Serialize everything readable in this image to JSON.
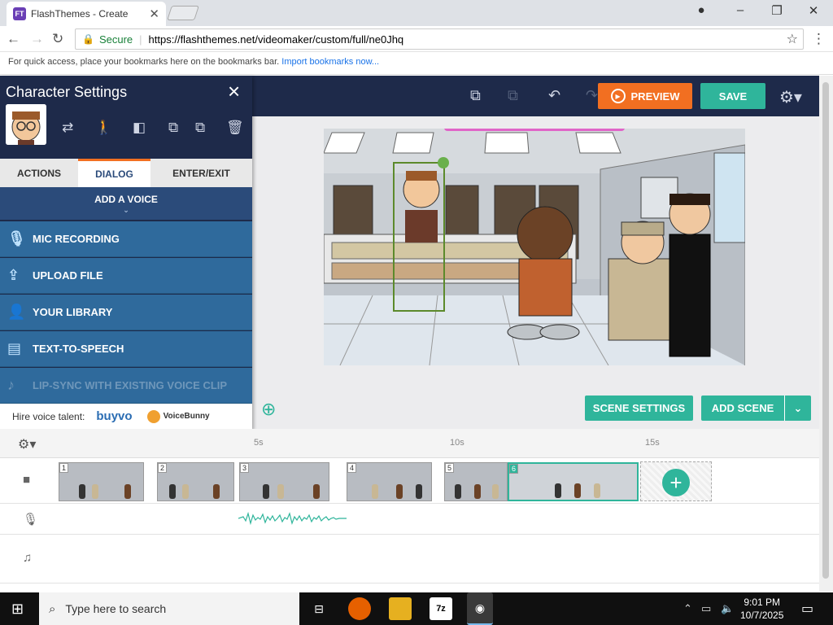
{
  "browser": {
    "tab_title": "FlashThemes - Create",
    "tab_close": "✕",
    "secure_label": "Secure",
    "url": "https://flashthemes.net/videomaker/custom/full/ne0Jhq",
    "bookmarks_text": "For quick access, place your bookmarks here on the bookmarks bar.",
    "bookmarks_link": "Import bookmarks now..."
  },
  "toolbar": {
    "preview_label": "PREVIEW",
    "save_label": "SAVE"
  },
  "panel": {
    "title": "Character Settings",
    "tabs": [
      "ACTIONS",
      "DIALOG",
      "ENTER/EXIT"
    ],
    "active_tab": "DIALOG",
    "add_voice": "ADD A VOICE",
    "voice_items": [
      {
        "label": "MIC RECORDING",
        "icon": "microphone-icon",
        "enabled": true
      },
      {
        "label": "UPLOAD FILE",
        "icon": "upload-icon",
        "enabled": true
      },
      {
        "label": "YOUR LIBRARY",
        "icon": "library-icon",
        "enabled": true
      },
      {
        "label": "TEXT-TO-SPEECH",
        "icon": "text-to-speech-icon",
        "enabled": true
      },
      {
        "label": "LIP-SYNC WITH EXISTING VOICE CLIP",
        "icon": "lipsync-icon",
        "enabled": false
      }
    ],
    "hire_label": "Hire voice talent:",
    "buyvo": "buyvo",
    "voicebunny": "VoiceBunny"
  },
  "scene_buttons": {
    "scene_settings": "SCENE SETTINGS",
    "add_scene": "ADD SCENE"
  },
  "timeline": {
    "ticks": [
      "5s",
      "10s",
      "15s"
    ],
    "scenes": [
      "1",
      "2",
      "3",
      "4",
      "5",
      "6"
    ]
  },
  "taskbar": {
    "search_placeholder": "Type here to search",
    "time": "9:01 PM",
    "date": "10/7/2025"
  },
  "colors": {
    "accent_orange": "#f26f21",
    "accent_teal": "#2fb59b",
    "panel_navy": "#1e2a4a",
    "voice_blue": "#2f6a9c"
  }
}
